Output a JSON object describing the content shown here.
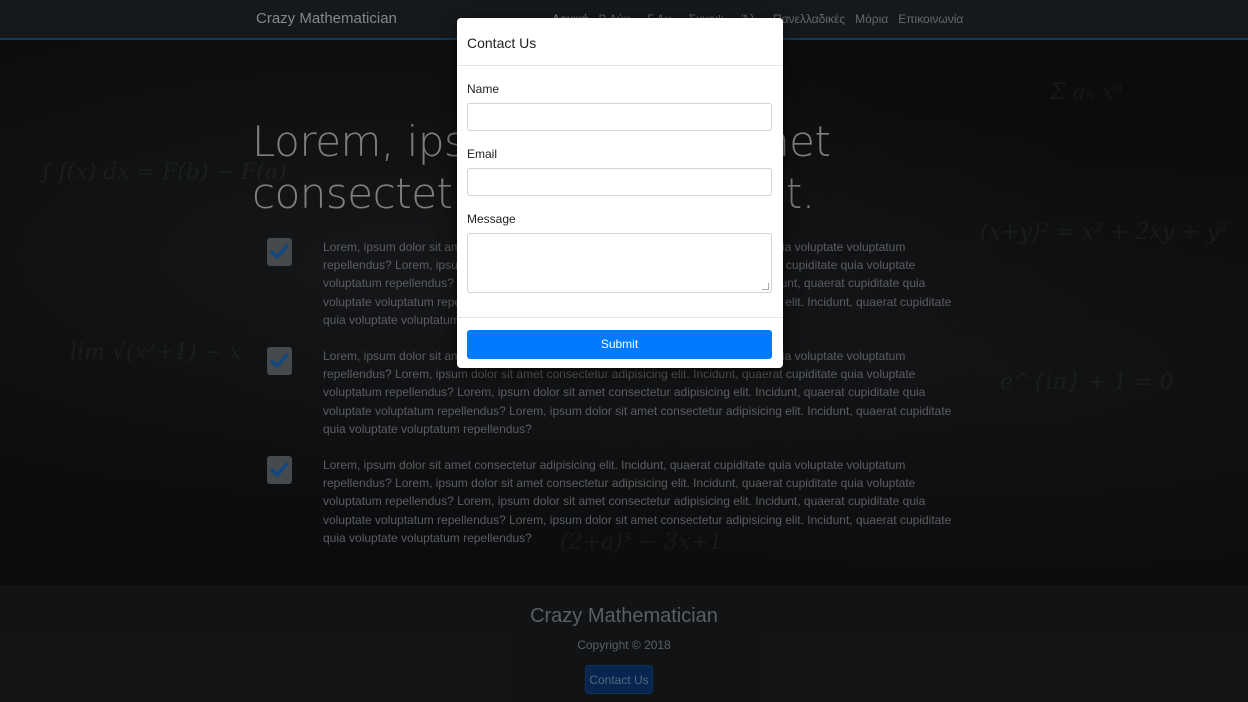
{
  "navbar": {
    "brand": "Crazy Mathematician",
    "links": [
      {
        "label": "Αρχική",
        "dropdown": false
      },
      {
        "label": "Β Λύκ",
        "dropdown": true
      },
      {
        "label": "Γ Λυ",
        "dropdown": true
      },
      {
        "label": "Συνοψ",
        "dropdown": true
      },
      {
        "label": "Άλ",
        "dropdown": true
      },
      {
        "label": "Πανελλαδικές",
        "dropdown": false
      },
      {
        "label": "Μόρια",
        "dropdown": false
      },
      {
        "label": "Επικοινωνία",
        "dropdown": false
      }
    ]
  },
  "hero": {
    "title": "Lorem, ipsum dolor sit amet consectetur adipisicing elit.",
    "features": [
      {
        "text": "Lorem, ipsum dolor sit amet consectetur adipisicing elit. Incidunt, quaerat cupiditate quia voluptate voluptatum repellendus? Lorem, ipsum dolor sit amet consectetur adipisicing elit. Incidunt, quaerat cupiditate quia voluptate voluptatum repellendus? Lorem, ipsum dolor sit amet consectetur adipisicing elit. Incidunt, quaerat cupiditate quia voluptate voluptatum repellendus? Lorem, ipsum dolor sit amet consectetur adipisicing elit. Incidunt, quaerat cupiditate quia voluptate voluptatum repellendus?"
      },
      {
        "text": "Lorem, ipsum dolor sit amet consectetur adipisicing elit. Incidunt, quaerat cupiditate quia voluptate voluptatum repellendus? Lorem, ipsum dolor sit amet consectetur adipisicing elit. Incidunt, quaerat cupiditate quia voluptate voluptatum repellendus? Lorem, ipsum dolor sit amet consectetur adipisicing elit. Incidunt, quaerat cupiditate quia voluptate voluptatum repellendus? Lorem, ipsum dolor sit amet consectetur adipisicing elit. Incidunt, quaerat cupiditate quia voluptate voluptatum repellendus?"
      },
      {
        "text": "Lorem, ipsum dolor sit amet consectetur adipisicing elit. Incidunt, quaerat cupiditate quia voluptate voluptatum repellendus? Lorem, ipsum dolor sit amet consectetur adipisicing elit. Incidunt, quaerat cupiditate quia voluptate voluptatum repellendus? Lorem, ipsum dolor sit amet consectetur adipisicing elit. Incidunt, quaerat cupiditate quia voluptate voluptatum repellendus? Lorem, ipsum dolor sit amet consectetur adipisicing elit. Incidunt, quaerat cupiditate quia voluptate voluptatum repellendus?"
      }
    ]
  },
  "modal": {
    "title": "Contact Us",
    "name_label": "Name",
    "name_value": "",
    "email_label": "Email",
    "email_value": "",
    "message_label": "Message",
    "message_value": "",
    "submit_label": "Submit"
  },
  "footer": {
    "title": "Crazy Mathematician",
    "copyright": "Copyright © 2018",
    "contact_button": "Contact Us"
  },
  "colors": {
    "primary": "#007bff",
    "navbar_bg": "#23272b",
    "navbar_accent": "#1e5a8c",
    "footer_bg": "#1b1e21"
  },
  "icons": {
    "feature_check": "check-icon",
    "dropdown": "caret-down-icon",
    "resize": "resize-grip-icon"
  }
}
